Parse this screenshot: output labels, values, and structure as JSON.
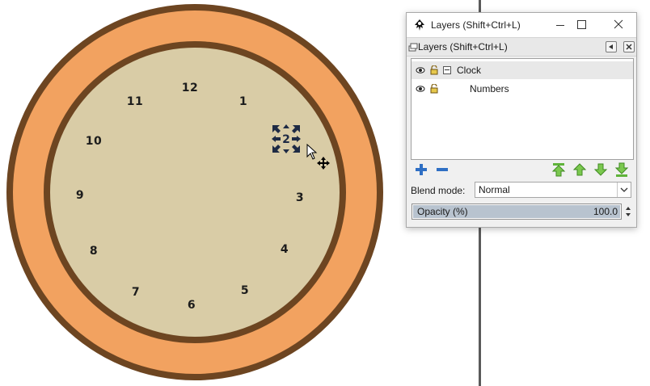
{
  "clock": {
    "numbers": [
      "12",
      "1",
      "2",
      "3",
      "4",
      "5",
      "6",
      "7",
      "8",
      "9",
      "10",
      "11"
    ]
  },
  "colors": {
    "outer_ring": "#6d4521",
    "orange_band": "#f2a260",
    "face": "#d9cca6",
    "number_text": "#1c1c1c",
    "selection": "#1e2a44"
  },
  "dialog": {
    "window_title": "Layers (Shift+Ctrl+L)",
    "panel_title": "Layers (Shift+Ctrl+L)",
    "layers": [
      {
        "name": "Clock",
        "visible_icon": "eye-icon",
        "lock_icon": "unlock-icon",
        "expanded": true
      },
      {
        "name": "Numbers",
        "visible_icon": "eye-icon",
        "lock_icon": "unlock-icon"
      }
    ],
    "blend_label": "Blend mode:",
    "blend_value": "Normal",
    "opacity_label": "Opacity (%)",
    "opacity_value": "100.0",
    "opacity_fraction": 1.0
  }
}
